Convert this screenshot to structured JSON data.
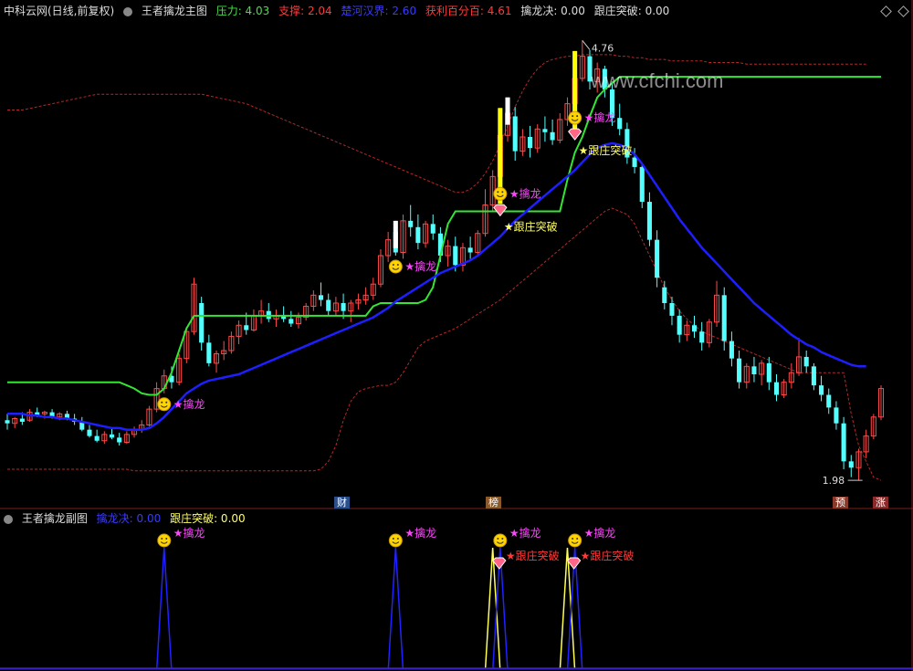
{
  "header": {
    "app": "中科云网(日线,前复权)",
    "indicator": "王者擒龙主图",
    "items": [
      {
        "label": "压力: 4.03",
        "color": "#4ade4a"
      },
      {
        "label": "支撑: 2.04",
        "color": "#ff3a3a"
      },
      {
        "label": "楚河汉界: 2.60",
        "color": "#3a3aff"
      },
      {
        "label": "获利百分百: 4.61",
        "color": "#ff3a3a"
      },
      {
        "label": "擒龙决: 0.00",
        "color": "#dddddd"
      },
      {
        "label": "跟庄突破: 0.00",
        "color": "#dddddd"
      }
    ]
  },
  "sub_header": {
    "indicator": "王者擒龙副图",
    "items": [
      {
        "label": "擒龙决: 0.00",
        "color": "#3a3aff"
      },
      {
        "label": "跟庄突破: 0.00",
        "color": "#ffff66"
      }
    ]
  },
  "watermark": "www.cfchi.com",
  "price_labels": {
    "high": "4.76",
    "low": "1.98"
  },
  "bottom_tags": [
    {
      "text": "财",
      "color": "#2a4f8a"
    },
    {
      "text": "榜",
      "color": "#8a5a2a"
    },
    {
      "text": "预",
      "color": "#8a3a2a"
    },
    {
      "text": "涨",
      "color": "#8a2a2a"
    }
  ],
  "signal_labels": {
    "qinlong": "★擒龙",
    "genzhuang": "★跟庄突破"
  },
  "chart_data": {
    "type": "candlestick",
    "candles": [
      [
        2.36,
        2.4,
        2.3,
        2.34
      ],
      [
        2.34,
        2.38,
        2.31,
        2.37
      ],
      [
        2.37,
        2.41,
        2.33,
        2.35
      ],
      [
        2.36,
        2.43,
        2.35,
        2.41
      ],
      [
        2.41,
        2.44,
        2.38,
        2.39
      ],
      [
        2.4,
        2.42,
        2.37,
        2.41
      ],
      [
        2.41,
        2.43,
        2.37,
        2.38
      ],
      [
        2.38,
        2.41,
        2.36,
        2.4
      ],
      [
        2.4,
        2.42,
        2.36,
        2.37
      ],
      [
        2.37,
        2.4,
        2.33,
        2.35
      ],
      [
        2.35,
        2.38,
        2.29,
        2.3
      ],
      [
        2.3,
        2.33,
        2.25,
        2.26
      ],
      [
        2.26,
        2.3,
        2.22,
        2.23
      ],
      [
        2.23,
        2.29,
        2.21,
        2.27
      ],
      [
        2.27,
        2.31,
        2.24,
        2.25
      ],
      [
        2.25,
        2.28,
        2.2,
        2.22
      ],
      [
        2.22,
        2.29,
        2.21,
        2.27
      ],
      [
        2.27,
        2.32,
        2.25,
        2.3
      ],
      [
        2.3,
        2.36,
        2.28,
        2.33
      ],
      [
        2.33,
        2.45,
        2.32,
        2.43
      ],
      [
        2.43,
        2.6,
        2.41,
        2.56
      ],
      [
        2.56,
        2.68,
        2.53,
        2.64
      ],
      [
        2.64,
        2.7,
        2.56,
        2.6
      ],
      [
        2.6,
        2.78,
        2.58,
        2.75
      ],
      [
        2.75,
        2.95,
        2.72,
        2.92
      ],
      [
        2.92,
        3.26,
        2.9,
        3.22
      ],
      [
        3.1,
        3.14,
        2.8,
        2.85
      ],
      [
        2.85,
        2.9,
        2.7,
        2.72
      ],
      [
        2.72,
        2.8,
        2.66,
        2.78
      ],
      [
        2.78,
        2.86,
        2.74,
        2.8
      ],
      [
        2.8,
        2.92,
        2.78,
        2.89
      ],
      [
        2.89,
        2.99,
        2.84,
        2.96
      ],
      [
        2.96,
        3.04,
        2.9,
        2.93
      ],
      [
        2.93,
        3.06,
        2.92,
        3.02
      ],
      [
        3.02,
        3.12,
        2.97,
        3.05
      ],
      [
        3.05,
        3.1,
        2.98,
        3.0
      ],
      [
        3.0,
        3.06,
        2.95,
        3.02
      ],
      [
        3.02,
        3.08,
        2.98,
        3.0
      ],
      [
        3.0,
        3.05,
        2.95,
        2.97
      ],
      [
        2.97,
        3.04,
        2.94,
        3.01
      ],
      [
        3.01,
        3.1,
        2.99,
        3.08
      ],
      [
        3.08,
        3.18,
        3.05,
        3.15
      ],
      [
        3.15,
        3.23,
        3.08,
        3.12
      ],
      [
        3.12,
        3.16,
        3.02,
        3.05
      ],
      [
        3.05,
        3.14,
        3.02,
        3.1
      ],
      [
        3.1,
        3.16,
        3.0,
        3.05
      ],
      [
        3.05,
        3.12,
        2.98,
        3.1
      ],
      [
        3.1,
        3.16,
        3.06,
        3.12
      ],
      [
        3.12,
        3.2,
        3.09,
        3.15
      ],
      [
        3.15,
        3.26,
        3.12,
        3.22
      ],
      [
        3.22,
        3.44,
        3.2,
        3.4
      ],
      [
        3.4,
        3.55,
        3.36,
        3.5
      ],
      [
        3.55,
        3.62,
        3.4,
        3.42
      ],
      [
        3.42,
        3.66,
        3.38,
        3.62
      ],
      [
        3.62,
        3.72,
        3.52,
        3.58
      ],
      [
        3.58,
        3.66,
        3.44,
        3.48
      ],
      [
        3.48,
        3.62,
        3.45,
        3.6
      ],
      [
        3.6,
        3.66,
        3.5,
        3.54
      ],
      [
        3.54,
        3.58,
        3.36,
        3.4
      ],
      [
        3.4,
        3.5,
        3.33,
        3.46
      ],
      [
        3.46,
        3.52,
        3.3,
        3.34
      ],
      [
        3.34,
        3.48,
        3.3,
        3.45
      ],
      [
        3.45,
        3.52,
        3.38,
        3.42
      ],
      [
        3.42,
        3.56,
        3.4,
        3.54
      ],
      [
        3.54,
        3.82,
        3.52,
        3.72
      ],
      [
        3.72,
        3.94,
        3.68,
        3.9
      ],
      [
        3.9,
        4.2,
        3.86,
        4.16
      ],
      [
        4.16,
        4.4,
        4.12,
        4.3
      ],
      [
        4.28,
        4.34,
        4.0,
        4.06
      ],
      [
        4.06,
        4.2,
        4.03,
        4.15
      ],
      [
        4.15,
        4.22,
        4.02,
        4.08
      ],
      [
        4.08,
        4.23,
        4.05,
        4.2
      ],
      [
        4.2,
        4.28,
        4.12,
        4.18
      ],
      [
        4.18,
        4.26,
        4.1,
        4.13
      ],
      [
        4.13,
        4.3,
        4.11,
        4.26
      ],
      [
        4.26,
        4.4,
        4.22,
        4.36
      ],
      [
        4.36,
        4.56,
        4.34,
        4.52
      ],
      [
        4.52,
        4.76,
        4.5,
        4.66
      ],
      [
        4.66,
        4.7,
        4.45,
        4.5
      ],
      [
        4.5,
        4.62,
        4.43,
        4.58
      ],
      [
        4.58,
        4.6,
        4.4,
        4.45
      ],
      [
        4.45,
        4.5,
        4.22,
        4.27
      ],
      [
        4.27,
        4.36,
        4.16,
        4.2
      ],
      [
        4.2,
        4.24,
        3.98,
        4.02
      ],
      [
        4.02,
        4.08,
        3.92,
        3.96
      ],
      [
        3.96,
        3.98,
        3.7,
        3.74
      ],
      [
        3.74,
        3.8,
        3.46,
        3.5
      ],
      [
        3.5,
        3.56,
        3.2,
        3.26
      ],
      [
        3.2,
        3.24,
        3.06,
        3.1
      ],
      [
        3.1,
        3.14,
        2.96,
        3.02
      ],
      [
        3.02,
        3.06,
        2.85,
        2.9
      ],
      [
        2.9,
        2.99,
        2.86,
        2.96
      ],
      [
        2.96,
        3.02,
        2.88,
        2.92
      ],
      [
        2.92,
        2.98,
        2.8,
        2.85
      ],
      [
        2.85,
        3.0,
        2.82,
        2.98
      ],
      [
        2.98,
        3.24,
        2.95,
        3.15
      ],
      [
        3.15,
        3.2,
        2.8,
        2.86
      ],
      [
        2.86,
        2.92,
        2.7,
        2.75
      ],
      [
        2.75,
        2.8,
        2.56,
        2.6
      ],
      [
        2.6,
        2.72,
        2.56,
        2.7
      ],
      [
        2.7,
        2.76,
        2.6,
        2.65
      ],
      [
        2.65,
        2.74,
        2.58,
        2.72
      ],
      [
        2.72,
        2.76,
        2.55,
        2.6
      ],
      [
        2.6,
        2.65,
        2.48,
        2.52
      ],
      [
        2.52,
        2.62,
        2.5,
        2.6
      ],
      [
        2.6,
        2.72,
        2.56,
        2.66
      ],
      [
        2.66,
        2.88,
        2.64,
        2.76
      ],
      [
        2.76,
        2.8,
        2.66,
        2.7
      ],
      [
        2.7,
        2.72,
        2.55,
        2.58
      ],
      [
        2.58,
        2.64,
        2.48,
        2.52
      ],
      [
        2.52,
        2.56,
        2.4,
        2.44
      ],
      [
        2.44,
        2.48,
        2.3,
        2.34
      ],
      [
        2.34,
        2.38,
        2.05,
        2.1
      ],
      [
        2.1,
        2.14,
        2.0,
        2.06
      ],
      [
        2.06,
        2.18,
        1.98,
        2.16
      ],
      [
        2.16,
        2.3,
        2.12,
        2.26
      ],
      [
        2.26,
        2.4,
        2.24,
        2.38
      ],
      [
        2.38,
        2.58,
        2.36,
        2.56
      ]
    ],
    "lines": {
      "pressure": [
        2.6,
        2.6,
        2.6,
        2.6,
        2.6,
        2.6,
        2.6,
        2.6,
        2.6,
        2.6,
        2.6,
        2.6,
        2.6,
        2.6,
        2.6,
        2.6,
        2.58,
        2.56,
        2.53,
        2.52,
        2.52,
        2.56,
        2.66,
        2.8,
        2.94,
        3.02,
        3.02,
        3.02,
        3.02,
        3.02,
        3.02,
        3.02,
        3.02,
        3.02,
        3.02,
        3.02,
        3.02,
        3.02,
        3.02,
        3.02,
        3.02,
        3.02,
        3.02,
        3.02,
        3.02,
        3.02,
        3.02,
        3.02,
        3.02,
        3.08,
        3.1,
        3.1,
        3.1,
        3.1,
        3.1,
        3.1,
        3.12,
        3.2,
        3.4,
        3.6,
        3.68,
        3.68,
        3.68,
        3.68,
        3.68,
        3.68,
        3.68,
        3.68,
        3.68,
        3.68,
        3.68,
        3.68,
        3.68,
        3.68,
        3.68,
        3.88,
        4.05,
        4.15,
        4.28,
        4.4,
        4.45,
        4.49,
        4.53,
        4.53,
        4.53,
        4.53,
        4.53,
        4.53,
        4.53,
        4.53,
        4.53,
        4.53,
        4.53,
        4.53,
        4.53,
        4.53,
        4.53,
        4.53,
        4.53,
        4.53,
        4.53,
        4.53,
        4.53,
        4.53,
        4.53,
        4.53,
        4.53,
        4.53,
        4.53,
        4.53,
        4.53,
        4.53,
        4.53,
        4.53,
        4.53,
        4.53,
        4.53,
        4.53
      ],
      "chu_he_han_jie": [
        2.4,
        2.4,
        2.4,
        2.39,
        2.39,
        2.38,
        2.38,
        2.37,
        2.37,
        2.36,
        2.35,
        2.34,
        2.33,
        2.32,
        2.31,
        2.31,
        2.3,
        2.3,
        2.3,
        2.31,
        2.34,
        2.38,
        2.43,
        2.48,
        2.53,
        2.56,
        2.59,
        2.61,
        2.62,
        2.63,
        2.64,
        2.65,
        2.67,
        2.69,
        2.71,
        2.73,
        2.75,
        2.77,
        2.79,
        2.81,
        2.83,
        2.85,
        2.87,
        2.89,
        2.91,
        2.93,
        2.95,
        2.97,
        2.99,
        3.01,
        3.04,
        3.07,
        3.11,
        3.14,
        3.17,
        3.2,
        3.23,
        3.26,
        3.29,
        3.31,
        3.33,
        3.35,
        3.37,
        3.4,
        3.44,
        3.48,
        3.52,
        3.57,
        3.62,
        3.66,
        3.7,
        3.74,
        3.78,
        3.82,
        3.86,
        3.9,
        3.94,
        3.99,
        4.04,
        4.08,
        4.1,
        4.11,
        4.1,
        4.08,
        4.04,
        3.98,
        3.91,
        3.84,
        3.77,
        3.7,
        3.63,
        3.57,
        3.51,
        3.45,
        3.4,
        3.35,
        3.3,
        3.25,
        3.2,
        3.15,
        3.1,
        3.06,
        3.02,
        2.98,
        2.94,
        2.9,
        2.87,
        2.84,
        2.82,
        2.79,
        2.77,
        2.75,
        2.73,
        2.71,
        2.7,
        2.7
      ],
      "support": [
        2.05,
        2.05,
        2.05,
        2.05,
        2.05,
        2.05,
        2.05,
        2.05,
        2.05,
        2.05,
        2.05,
        2.05,
        2.05,
        2.05,
        2.05,
        2.05,
        2.05,
        2.04,
        2.04,
        2.04,
        2.04,
        2.04,
        2.04,
        2.04,
        2.04,
        2.04,
        2.04,
        2.04,
        2.04,
        2.04,
        2.04,
        2.04,
        2.04,
        2.04,
        2.04,
        2.04,
        2.04,
        2.04,
        2.04,
        2.04,
        2.04,
        2.04,
        2.05,
        2.1,
        2.2,
        2.36,
        2.48,
        2.54,
        2.56,
        2.57,
        2.58,
        2.58,
        2.6,
        2.66,
        2.74,
        2.82,
        2.86,
        2.88,
        2.9,
        2.92,
        2.94,
        2.97,
        3.0,
        3.03,
        3.06,
        3.09,
        3.12,
        3.16,
        3.2,
        3.24,
        3.28,
        3.32,
        3.36,
        3.4,
        3.44,
        3.48,
        3.52,
        3.56,
        3.6,
        3.64,
        3.68,
        3.7,
        3.68,
        3.66,
        3.6,
        3.5,
        3.4,
        3.3,
        3.2,
        3.12,
        3.05,
        3.0,
        2.96,
        2.92,
        2.9,
        2.88,
        2.86,
        2.84,
        2.82,
        2.8,
        2.78,
        2.76,
        2.74,
        2.72,
        2.7,
        2.68,
        2.66,
        2.66,
        2.66,
        2.66,
        2.66,
        2.66,
        2.66,
        2.4,
        2.2,
        2.1,
        2.0,
        1.98
      ],
      "profit_100": [
        4.32,
        4.32,
        4.32,
        4.33,
        4.34,
        4.35,
        4.36,
        4.37,
        4.38,
        4.39,
        4.4,
        4.41,
        4.42,
        4.42,
        4.42,
        4.42,
        4.42,
        4.42,
        4.42,
        4.42,
        4.42,
        4.42,
        4.42,
        4.42,
        4.42,
        4.42,
        4.42,
        4.41,
        4.4,
        4.39,
        4.38,
        4.37,
        4.36,
        4.34,
        4.32,
        4.3,
        4.28,
        4.26,
        4.24,
        4.22,
        4.2,
        4.18,
        4.16,
        4.14,
        4.12,
        4.1,
        4.08,
        4.06,
        4.04,
        4.02,
        4.0,
        3.98,
        3.96,
        3.94,
        3.92,
        3.9,
        3.88,
        3.86,
        3.84,
        3.82,
        3.8,
        3.8,
        3.82,
        3.86,
        3.92,
        4.0,
        4.1,
        4.22,
        4.34,
        4.44,
        4.52,
        4.58,
        4.62,
        4.64,
        4.65,
        4.66,
        4.66,
        4.67,
        4.67,
        4.67,
        4.67,
        4.67,
        4.66,
        4.66,
        4.65,
        4.65,
        4.64,
        4.64,
        4.64,
        4.63,
        4.63,
        4.63,
        4.63,
        4.63,
        4.62,
        4.62,
        4.62,
        4.62,
        4.62,
        4.61,
        4.61,
        4.61,
        4.61,
        4.61,
        4.61,
        4.61,
        4.61,
        4.61,
        4.61,
        4.61,
        4.61,
        4.61,
        4.61,
        4.61,
        4.61,
        4.61
      ]
    },
    "qinlong_signals": [
      21,
      52,
      66,
      76
    ],
    "genzhuang_signals": [
      66,
      76
    ],
    "yellow_bars": [
      66,
      76
    ],
    "white_bars": [
      52,
      67
    ],
    "price_range": [
      1.9,
      4.9
    ]
  }
}
